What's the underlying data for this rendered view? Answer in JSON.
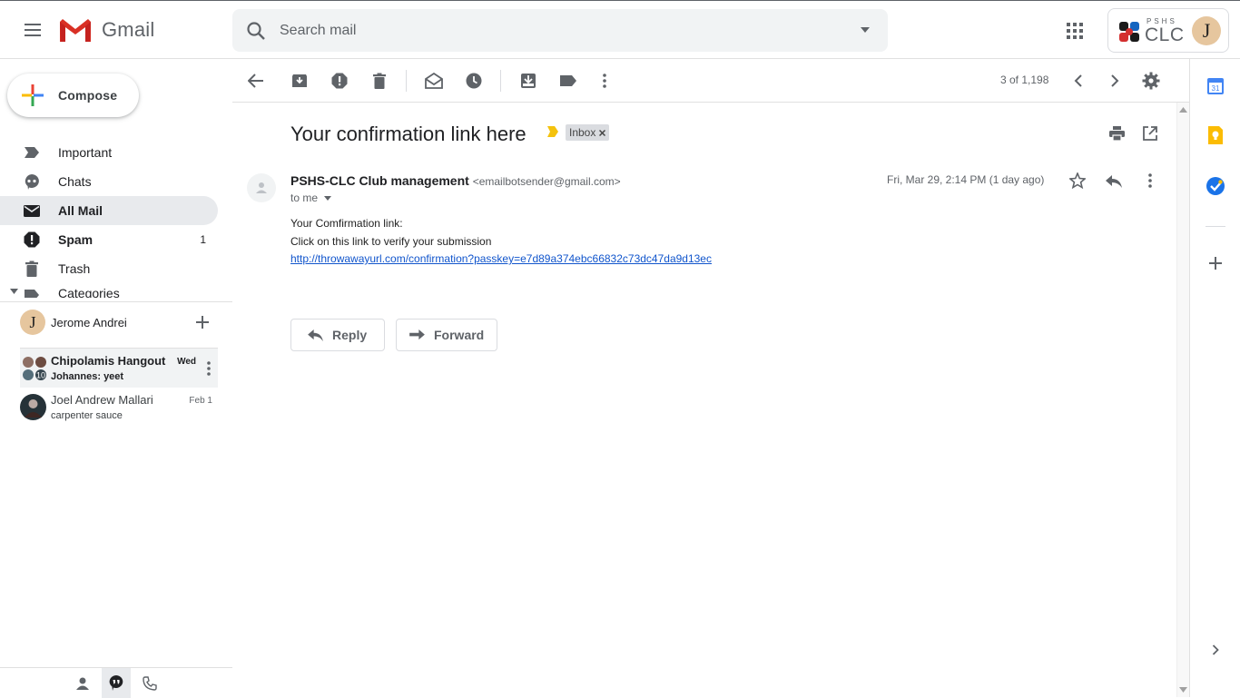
{
  "app": {
    "name": "Gmail",
    "org_small": "PSHS",
    "org_big": "CLC",
    "user_initial": "J"
  },
  "search": {
    "placeholder": "Search mail"
  },
  "compose": {
    "label": "Compose"
  },
  "nav": {
    "items": [
      {
        "label": "Important",
        "icon": "label-important-icon",
        "count": ""
      },
      {
        "label": "Chats",
        "icon": "chat-bubble-icon",
        "count": ""
      },
      {
        "label": "All Mail",
        "icon": "mail-icon",
        "count": ""
      },
      {
        "label": "Spam",
        "icon": "report-spam-icon",
        "count": "1"
      },
      {
        "label": "Trash",
        "icon": "trash-icon",
        "count": ""
      },
      {
        "label": "Categories",
        "icon": "label-icon",
        "count": ""
      }
    ]
  },
  "hangouts": {
    "me": "Jerome Andrei",
    "conversations": [
      {
        "name": "Chipolamis Hangout",
        "message": "Johannes: yeet",
        "date": "Wed",
        "unread": true
      },
      {
        "name": "Joel Andrew Mallari",
        "message": "carpenter sauce",
        "date": "Feb 1",
        "unread": false
      }
    ]
  },
  "toolbar": {
    "page_count": "3 of 1,198"
  },
  "email": {
    "subject": "Your confirmation link here",
    "label": "Inbox",
    "sender_name": "PSHS-CLC Club management",
    "sender_email": "<emailbotsender@gmail.com>",
    "to": "to me",
    "date": "Fri, Mar 29, 2:14 PM (1 day ago)",
    "body_line1": "Your Comfirmation link:",
    "body_line2": "Click on this link to verify your submission",
    "link": "http://throwawayurl.com/confirmation?passkey=e7d89a374ebc66832c73dc47da9d13ec",
    "reply_label": "Reply",
    "forward_label": "Forward"
  },
  "colors": {
    "accent": "#1a73e8",
    "active_nav": "#e8eaed",
    "link": "#1155cc",
    "important_yellow": "#f4c20d"
  }
}
